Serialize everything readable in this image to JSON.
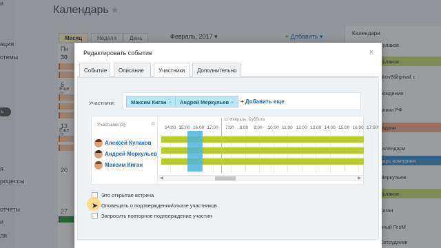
{
  "app": {
    "page_title": "Календарь",
    "nav_fragments": [
      "ки",
      "ация",
      "стемы",
      "ь",
      "я",
      "роцессы",
      "отчеты",
      "и",
      "ля"
    ],
    "nav_badge": "ь",
    "view_tabs": [
      "Месяц",
      "Неделя",
      "День"
    ],
    "month_label": "Февраль, 2017",
    "add_button": "Добавить",
    "day_numbers": [
      "Пн",
      "30",
      "6",
      "13",
      "20",
      "27"
    ],
    "more_labels": [
      "Еще (2",
      "Еще (2"
    ],
    "right_panel": {
      "header": "Календари",
      "rows": [
        "Кулаков",
        "akov8@gmail.c",
        "рождения",
        "дники РФ",
        "задачи",
        "календари",
        "дарь компании",
        "Меркульев",
        "Кулаков",
        "Киган",
        "ьный ГеоМ",
        "Сотрудники"
      ]
    }
  },
  "modal": {
    "title": "Редактировать событие",
    "close_glyph": "×",
    "tabs": [
      "Событие",
      "Описание",
      "Участники",
      "Дополнительно"
    ],
    "active_tab": "Участники",
    "participants_label": "Участники:",
    "chips": [
      "Максим Киган",
      "Андрей Меркульев"
    ],
    "chip_remove": "×",
    "add_more": "+ Добавить еще",
    "planner": {
      "count_label": "Участники (3)",
      "date_label": "11 Февраль, Суббота",
      "time_ticks": [
        "14:00",
        "15:00",
        "16:00",
        "17:00",
        "7:00",
        "8:00",
        "9:00",
        "10:00",
        "11:00",
        "12:00",
        "13:00",
        "14:00",
        "15:00",
        "16:00",
        "17:00"
      ],
      "people": [
        "Алексей Кулаков",
        "Андрей Меркульев",
        "Максим Киган"
      ]
    },
    "checkboxes": [
      {
        "label": "Это открытая встреча",
        "checked": false
      },
      {
        "label": "Оповещать о подтверждении/отказе участников",
        "checked": false
      },
      {
        "label": "Запросить повторное подтверждение участия",
        "checked": false
      }
    ],
    "colors": {
      "busy_bar": "#b8cc28",
      "selection": "#4cb4e1",
      "chip_bg": "#bde6f7",
      "link": "#2067b0"
    }
  }
}
